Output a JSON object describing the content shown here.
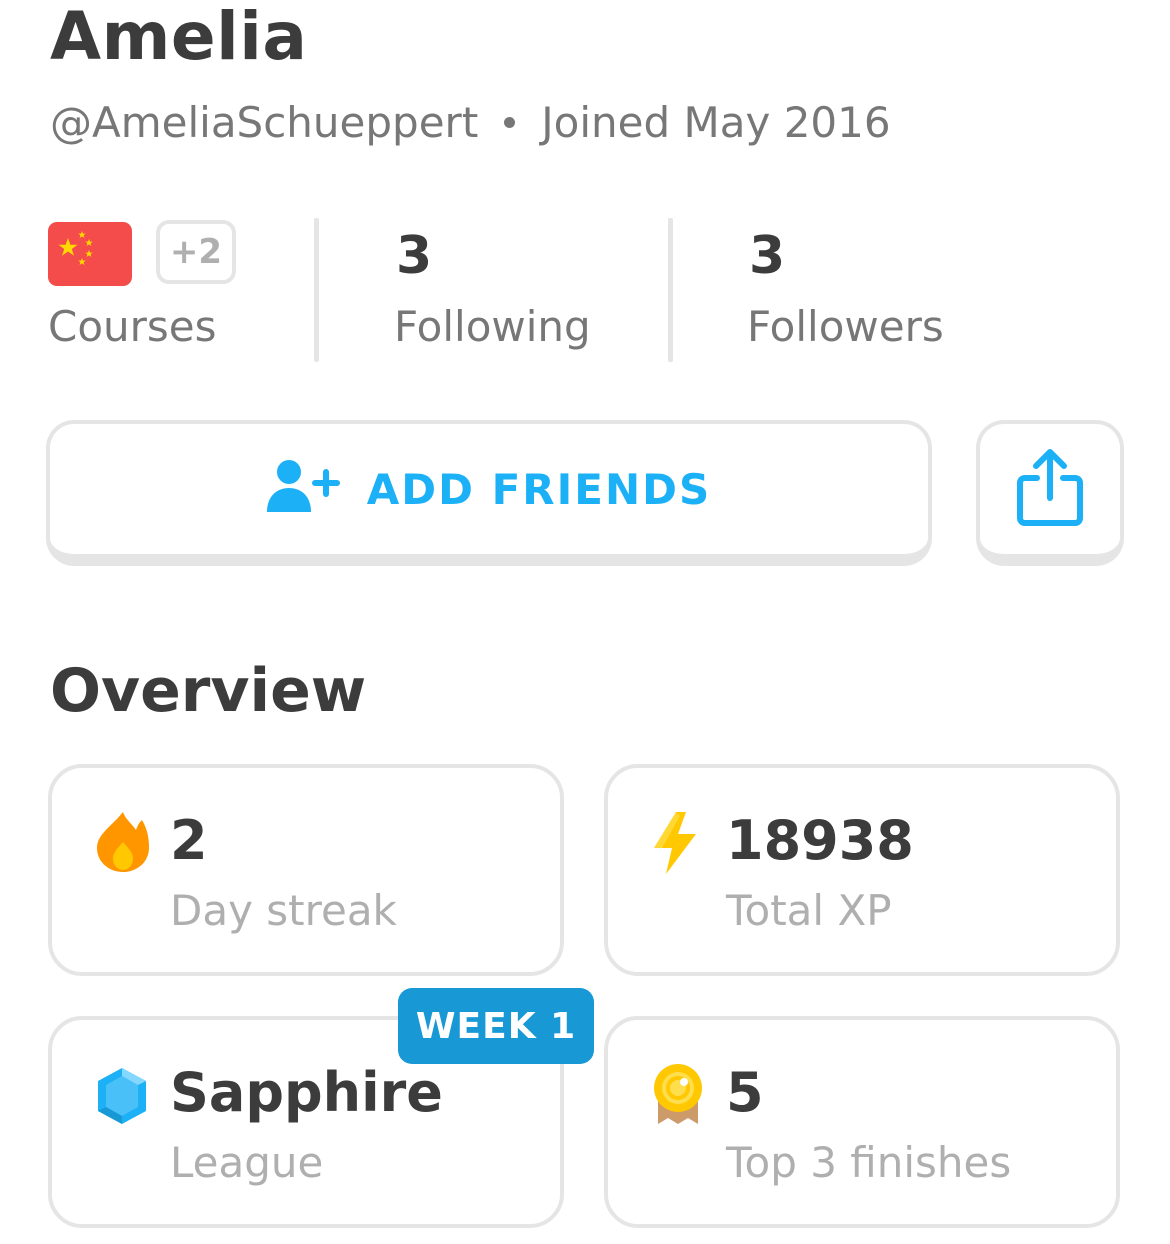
{
  "profile": {
    "name": "Amelia",
    "username": "@AmeliaSchueppert",
    "joined": "Joined May 2016"
  },
  "stats": {
    "courses_more": "+2",
    "courses_label": "Courses",
    "following_count": "3",
    "following_label": "Following",
    "followers_count": "3",
    "followers_label": "Followers",
    "flag_icon": "china-flag-icon"
  },
  "actions": {
    "add_friends_label": "ADD FRIENDS",
    "share_icon": "share-icon"
  },
  "overview": {
    "title": "Overview",
    "cards": [
      {
        "value": "2",
        "caption": "Day streak",
        "icon": "flame-icon"
      },
      {
        "value": "18938",
        "caption": "Total XP",
        "icon": "lightning-icon"
      },
      {
        "value": "Sapphire",
        "caption": "League",
        "icon": "sapphire-gem-icon",
        "badge": "WEEK 1"
      },
      {
        "value": "5",
        "caption": "Top 3 finishes",
        "icon": "medal-icon"
      }
    ]
  },
  "colors": {
    "accent": "#1cb0f6",
    "badge": "#1899d6",
    "text": "#3c3c3c",
    "muted": "#afafaf",
    "border": "#e5e5e5"
  }
}
